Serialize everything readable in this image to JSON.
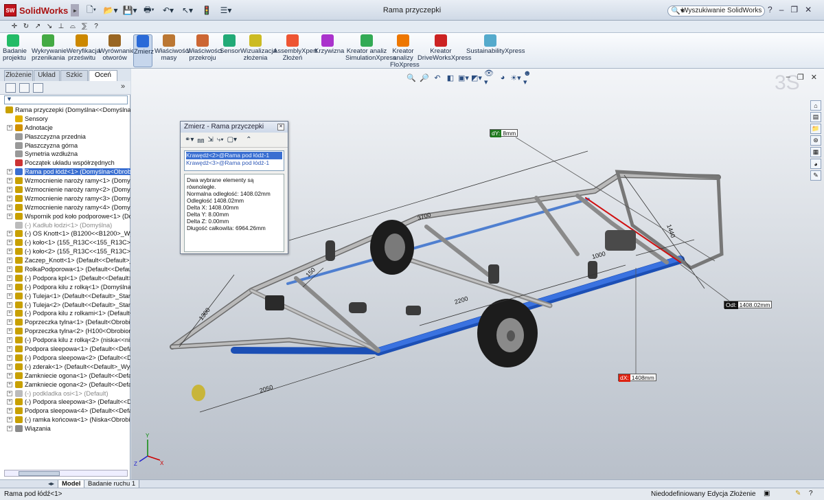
{
  "app": {
    "logo": "SolidWorks",
    "title": "Rama przyczepki",
    "search_placeholder": "Wyszukiwanie SolidWorks",
    "help": "?"
  },
  "ribbon": [
    {
      "id": "badanie",
      "label": "Badanie projektu",
      "icon": "study-icon"
    },
    {
      "id": "wykrywanie",
      "label": "Wykrywanie przenikania",
      "icon": "interference-icon"
    },
    {
      "id": "weryfikacja",
      "label": "Weryfikacja prześwitu",
      "icon": "clearance-icon"
    },
    {
      "id": "wyrownanie",
      "label": "Wyrównanie otworów",
      "icon": "hole-align-icon"
    },
    {
      "id": "zmierz",
      "label": "Zmierz",
      "icon": "measure-icon",
      "active": true
    },
    {
      "id": "wlasciwosci",
      "label": "Właściwości masy",
      "icon": "mass-icon"
    },
    {
      "id": "przekroj",
      "label": "Właściwości przekroju",
      "icon": "section-icon"
    },
    {
      "id": "sensor",
      "label": "Sensor",
      "icon": "sensor-icon"
    },
    {
      "id": "wizualizacja",
      "label": "Wizualizacja złożenia",
      "icon": "visualize-icon"
    },
    {
      "id": "assemblyxpert",
      "label": "AssemblyXpert Złożeń",
      "icon": "xpert-icon"
    },
    {
      "id": "krzywizna",
      "label": "Krzywizna",
      "icon": "curvature-icon"
    },
    {
      "id": "simulation",
      "label": "Kreator analiz SimulationXpress",
      "icon": "simulation-icon"
    },
    {
      "id": "floxpress",
      "label": "Kreator analizy FloXpress",
      "icon": "flo-icon"
    },
    {
      "id": "driveworks",
      "label": "Kreator DriveWorksXpress",
      "icon": "driveworks-icon"
    },
    {
      "id": "sustain",
      "label": "SustainabilityXpress",
      "icon": "sustain-icon"
    }
  ],
  "tabs": [
    "Złożenie",
    "Układ",
    "Szkic",
    "Oceń"
  ],
  "active_tab": "Oceń",
  "tree": [
    {
      "label": "Rama przyczepki  (Domyślna<<Domyślna>_",
      "color": "#c8a000",
      "exp": ""
    },
    {
      "label": "Sensory",
      "color": "#e0b000",
      "exp": ""
    },
    {
      "label": "Adnotacje",
      "color": "#d09000",
      "exp": "+"
    },
    {
      "label": "Płaszczyzna przednia",
      "color": "#999",
      "exp": ""
    },
    {
      "label": "Płaszczyzna górna",
      "color": "#999",
      "exp": ""
    },
    {
      "label": "Symetria wzdłużna",
      "color": "#999",
      "exp": ""
    },
    {
      "label": "Początek układu współrzędnych",
      "color": "#c33",
      "exp": ""
    },
    {
      "label": "Rama pod łódź<1> (Domyślna<Obrobio",
      "color": "#3a6fd1",
      "exp": "+",
      "sel": true
    },
    {
      "label": "Wzmocnienie naroży ramy<1> (Domyśl",
      "color": "#c8a000",
      "exp": "+"
    },
    {
      "label": "Wzmocnienie naroży ramy<2> (Domyśl",
      "color": "#c8a000",
      "exp": "+"
    },
    {
      "label": "Wzmocnienie naroży ramy<3> (Domyśl",
      "color": "#c8a000",
      "exp": "+"
    },
    {
      "label": "Wzmocnienie naroży ramy<4> (Domyśl",
      "color": "#c8a000",
      "exp": "+"
    },
    {
      "label": "Wspornik pod koło podporowe<1> (Dor",
      "color": "#c8a000",
      "exp": "+"
    },
    {
      "label": "(-) Kadłub łodzi<1> (Domyślna)",
      "color": "#bbb",
      "exp": "",
      "grey": true
    },
    {
      "label": "(-) OS Knott<1> (B1200<<B1200>_Wygl",
      "color": "#c8a000",
      "exp": "+"
    },
    {
      "label": "(-) koło<1> (155_R13C<<155_R13C>_Sta",
      "color": "#c8a000",
      "exp": "+"
    },
    {
      "label": "(-) koło<2> (155_R13C<<155_R13C>_Sta",
      "color": "#c8a000",
      "exp": "+"
    },
    {
      "label": "Zaczep_Knott<1> (Default<<Default>_S",
      "color": "#c8a000",
      "exp": "+"
    },
    {
      "label": "RolkaPodporowa<1> (Default<<Default",
      "color": "#c8a000",
      "exp": "+"
    },
    {
      "label": "(-) Podpora kpl<1> (Default<<Default>_",
      "color": "#c8a000",
      "exp": "+"
    },
    {
      "label": "(-) Podpora kilu z rolką<1> (Domyślna<I",
      "color": "#c8a000",
      "exp": "+"
    },
    {
      "label": "(-) Tuleja<1> (Default<<Default>_Stan w",
      "color": "#c8a000",
      "exp": "+"
    },
    {
      "label": "(-) Tuleja<2> (Default<<Default>_Stan w",
      "color": "#c8a000",
      "exp": "+"
    },
    {
      "label": "(-) Podpora kilu z rolkami<1> (Default<",
      "color": "#c8a000",
      "exp": "+"
    },
    {
      "label": "Poprzeczka tylna<1> (Default<Obrobior",
      "color": "#c8a000",
      "exp": "+"
    },
    {
      "label": "Poprzeczka tylna<2> (H100<Obrobiona",
      "color": "#c8a000",
      "exp": "+"
    },
    {
      "label": "(-) Podpora kilu z rolką<2> (niska<<nisk",
      "color": "#c8a000",
      "exp": "+"
    },
    {
      "label": "Podpora sleepowa<1> (Default<<Defau",
      "color": "#c8a000",
      "exp": "+"
    },
    {
      "label": "(-) Podpora sleepowa<2> (Default<<De",
      "color": "#c8a000",
      "exp": "+"
    },
    {
      "label": "(-) zderak<1> (Default<<Default>_Wygl",
      "color": "#c8a000",
      "exp": "+"
    },
    {
      "label": "Zamkniecie ogona<1> (Default<<Defau",
      "color": "#c8a000",
      "exp": "+"
    },
    {
      "label": "Zamkniecie ogona<2> (Default<<Defau",
      "color": "#c8a000",
      "exp": "+"
    },
    {
      "label": "(-) podkladka osi<1> (Default)",
      "color": "#bbb",
      "exp": "+",
      "grey": true
    },
    {
      "label": "(-) Podpora sleepowa<3> (Default<<De",
      "color": "#c8a000",
      "exp": "+"
    },
    {
      "label": "Podpora sleepowa<4> (Default<<Defau",
      "color": "#c8a000",
      "exp": "+"
    },
    {
      "label": "(-) ramka końcowa<1> (Niska<Obrobio",
      "color": "#c8a000",
      "exp": "+"
    },
    {
      "label": "Wiązania",
      "color": "#8a8a8a",
      "exp": "+"
    }
  ],
  "measure": {
    "title": "Zmierz - Rama przyczepki",
    "selections": [
      "Krawędź<2>@Rama pod łódź-1",
      "Krawędź<3>@Rama pod łódź-1"
    ],
    "results": [
      "Dwa wybrane elementy są równoległe.",
      "Normalna odległość: 1408.02mm",
      "Odległość 1408.02mm",
      "Delta X: 1408.00mm",
      "Delta Y: 8.00mm",
      "Delta Z: 0.00mm",
      "Długość całkowita: 6964.26mm"
    ]
  },
  "callouts": {
    "dy": {
      "tag": "dY:",
      "value": "8mm",
      "color": "#1e7a1e"
    },
    "odl": {
      "tag": "Odl:",
      "value": "1408.02mm",
      "color": "#111"
    },
    "dx": {
      "tag": "dX:",
      "value": "1408mm",
      "color": "#d21"
    }
  },
  "dims": [
    "3700",
    "1440",
    "1000",
    "2200",
    "1300",
    "2050",
    "150"
  ],
  "bottom_tabs": [
    "Model",
    "Badanie ruchu 1"
  ],
  "status": {
    "selection": "Rama pod łódź<1>",
    "state": "Niedodefiniowany",
    "mode": "Edycja Złożenie"
  }
}
